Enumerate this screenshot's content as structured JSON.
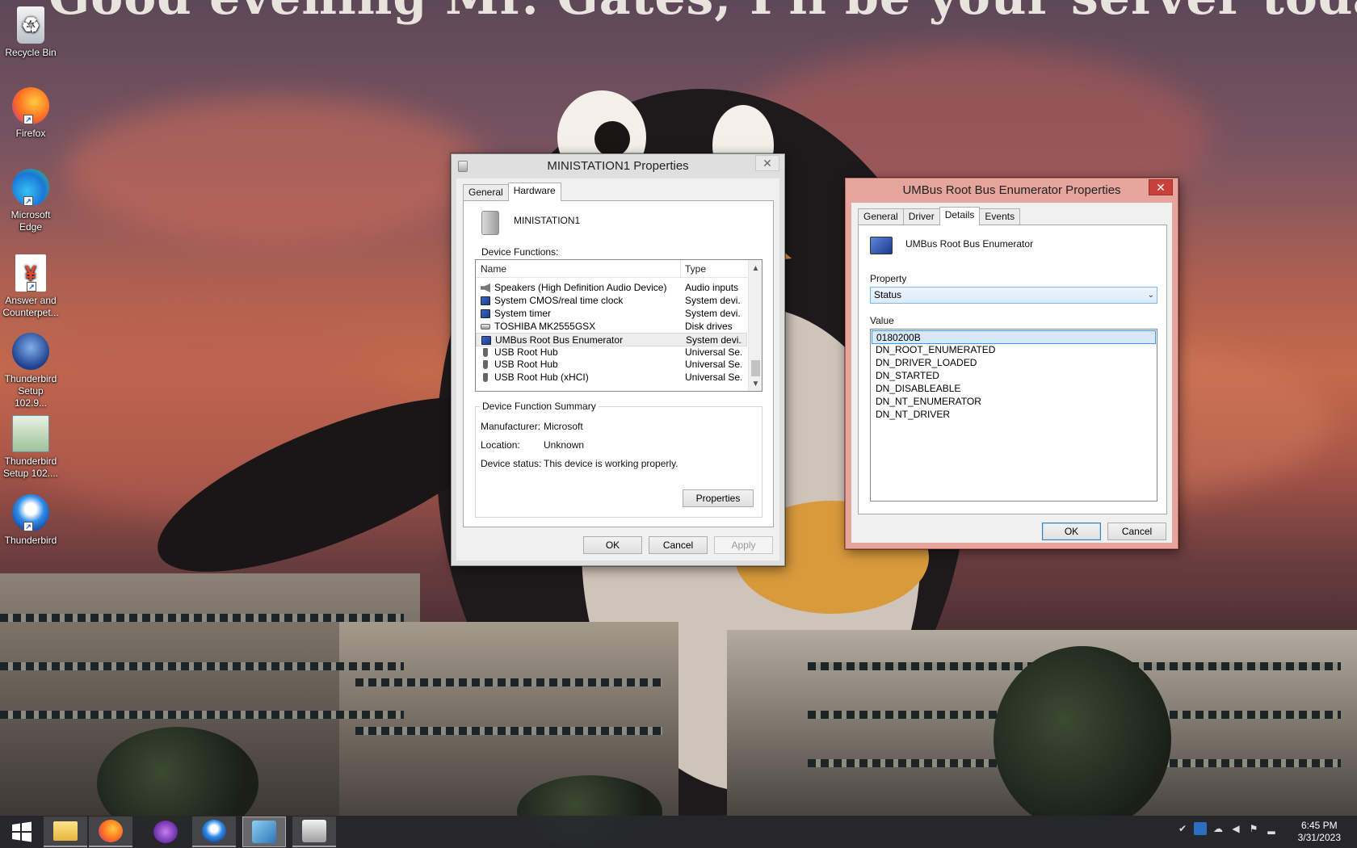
{
  "wallpaper": {
    "banner_text": "Good evening Mr. Gates, I'll be your server today."
  },
  "desktop_icons": [
    {
      "label": "Recycle Bin",
      "icon": "recycle-bin-icon"
    },
    {
      "label": "Firefox",
      "icon": "firefox-icon"
    },
    {
      "label": "Microsoft Edge",
      "icon": "edge-icon"
    },
    {
      "label": "Answer and Counterpet...",
      "icon": "document-icon"
    },
    {
      "label": "Thunderbird Setup 102.9...",
      "icon": "thunderbird-setup-icon"
    },
    {
      "label": "Thunderbird Setup 102....",
      "icon": "installer-icon"
    },
    {
      "label": "Thunderbird",
      "icon": "thunderbird-icon"
    }
  ],
  "dialog1": {
    "title": "MINISTATION1 Properties",
    "close": "✕",
    "tabs": [
      "General",
      "Hardware"
    ],
    "active_tab": "Hardware",
    "device_name": "MINISTATION1",
    "device_functions_label": "Device Functions:",
    "columns": [
      "Name",
      "Type"
    ],
    "rows": [
      {
        "name": "Speakers (High Definition Audio Device)",
        "type": "Audio inputs ...",
        "icon": "speaker"
      },
      {
        "name": "System CMOS/real time clock",
        "type": "System devi...",
        "icon": "monitor"
      },
      {
        "name": "System timer",
        "type": "System devi...",
        "icon": "monitor"
      },
      {
        "name": "TOSHIBA MK2555GSX",
        "type": "Disk drives",
        "icon": "disk"
      },
      {
        "name": "UMBus Root Bus Enumerator",
        "type": "System devi...",
        "icon": "monitor"
      },
      {
        "name": "USB Root Hub",
        "type": "Universal Se...",
        "icon": "usb"
      },
      {
        "name": "USB Root Hub",
        "type": "Universal Se...",
        "icon": "usb"
      },
      {
        "name": "USB Root Hub (xHCI)",
        "type": "Universal Se...",
        "icon": "usb"
      }
    ],
    "selected_row": "UMBus Root Bus Enumerator",
    "summary_legend": "Device Function Summary",
    "manufacturer_label": "Manufacturer:",
    "manufacturer": "Microsoft",
    "location_label": "Location:",
    "location": "Unknown",
    "status_label": "Device status:",
    "status": "This device is working properly.",
    "properties_button": "Properties",
    "ok": "OK",
    "cancel": "Cancel",
    "apply": "Apply"
  },
  "dialog2": {
    "title": "UMBus Root Bus Enumerator Properties",
    "close": "✕",
    "tabs": [
      "General",
      "Driver",
      "Details",
      "Events"
    ],
    "active_tab": "Details",
    "device_name": "UMBus Root Bus Enumerator",
    "property_label": "Property",
    "property_value": "Status",
    "value_label": "Value",
    "values": [
      "0180200B",
      "DN_ROOT_ENUMERATED",
      "DN_DRIVER_LOADED",
      "DN_STARTED",
      "DN_DISABLEABLE",
      "DN_NT_ENUMERATOR",
      "DN_NT_DRIVER"
    ],
    "selected_value": "0180200B",
    "ok": "OK",
    "cancel": "Cancel"
  },
  "taskbar": {
    "buttons": [
      {
        "name": "start-button",
        "icon": "windows-logo-icon"
      },
      {
        "name": "file-explorer",
        "icon": "folder-icon"
      },
      {
        "name": "firefox",
        "icon": "firefox-icon"
      },
      {
        "name": "private-browser",
        "icon": "mask-icon"
      },
      {
        "name": "thunderbird",
        "icon": "thunderbird-icon"
      },
      {
        "name": "device-manager",
        "icon": "computer-icon"
      },
      {
        "name": "devices-printers",
        "icon": "printer-icon"
      }
    ],
    "tray_icons": [
      "security-icon",
      "network-adapter-icon",
      "chat-icon",
      "volume-icon",
      "flag-icon",
      "signal-icon"
    ],
    "time": "6:45 PM",
    "date": "3/31/2023"
  }
}
